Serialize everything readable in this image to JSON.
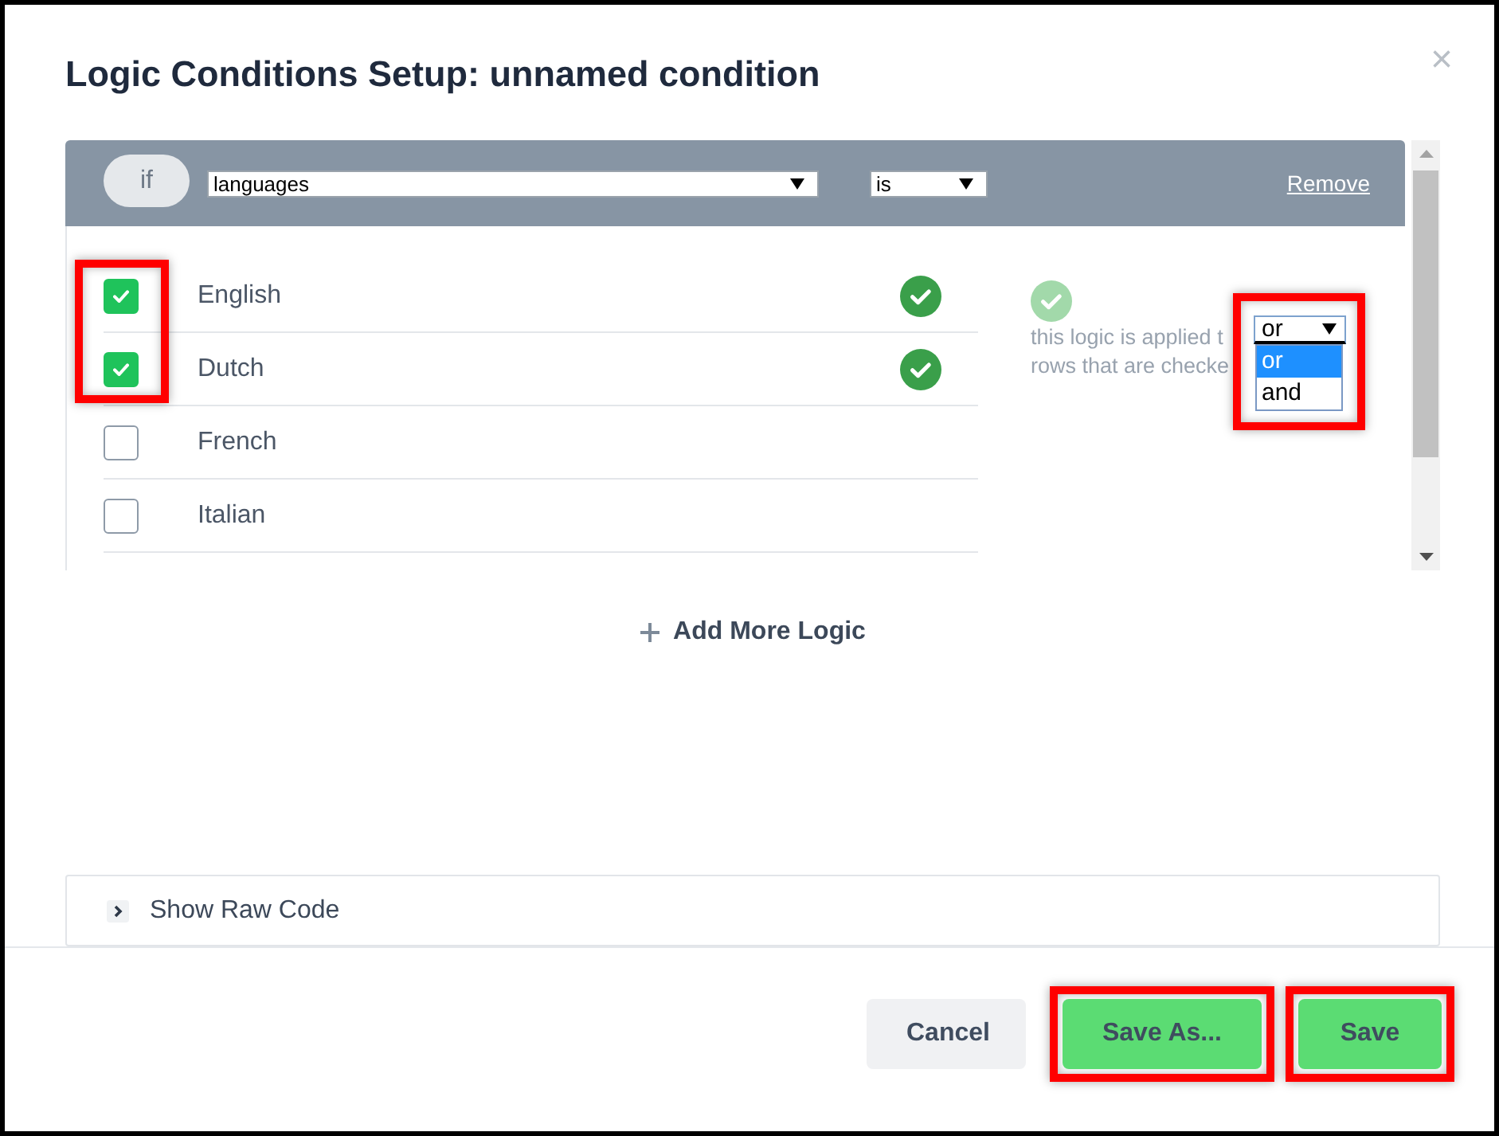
{
  "dialog": {
    "title": "Logic Conditions Setup: unnamed condition",
    "close": "×"
  },
  "condition": {
    "prefix": "if",
    "field": {
      "value": "languages"
    },
    "operator": {
      "value": "is"
    },
    "remove": "Remove",
    "rows": [
      {
        "label": "English",
        "checked": true,
        "highlighted": true
      },
      {
        "label": "Dutch",
        "checked": true,
        "highlighted": true
      },
      {
        "label": "French",
        "checked": false,
        "highlighted": false
      },
      {
        "label": "Italian",
        "checked": false,
        "highlighted": false
      }
    ],
    "note": {
      "lines": [
        "this logic is applied t",
        "rows that are checke"
      ]
    },
    "conjunction": {
      "value": "or",
      "expanded": true,
      "highlighted": true,
      "options": [
        {
          "label": "or",
          "selected": true
        },
        {
          "label": "and",
          "selected": false
        }
      ]
    }
  },
  "add_logic": {
    "label": "Add More Logic"
  },
  "raw_code": {
    "label": "Show Raw Code",
    "expanded": false
  },
  "buttons": [
    {
      "label": "Cancel",
      "kind": "secondary",
      "highlighted": false
    },
    {
      "label": "Save As...",
      "kind": "primary",
      "highlighted": true
    },
    {
      "label": "Save",
      "kind": "primary",
      "highlighted": true
    }
  ]
}
